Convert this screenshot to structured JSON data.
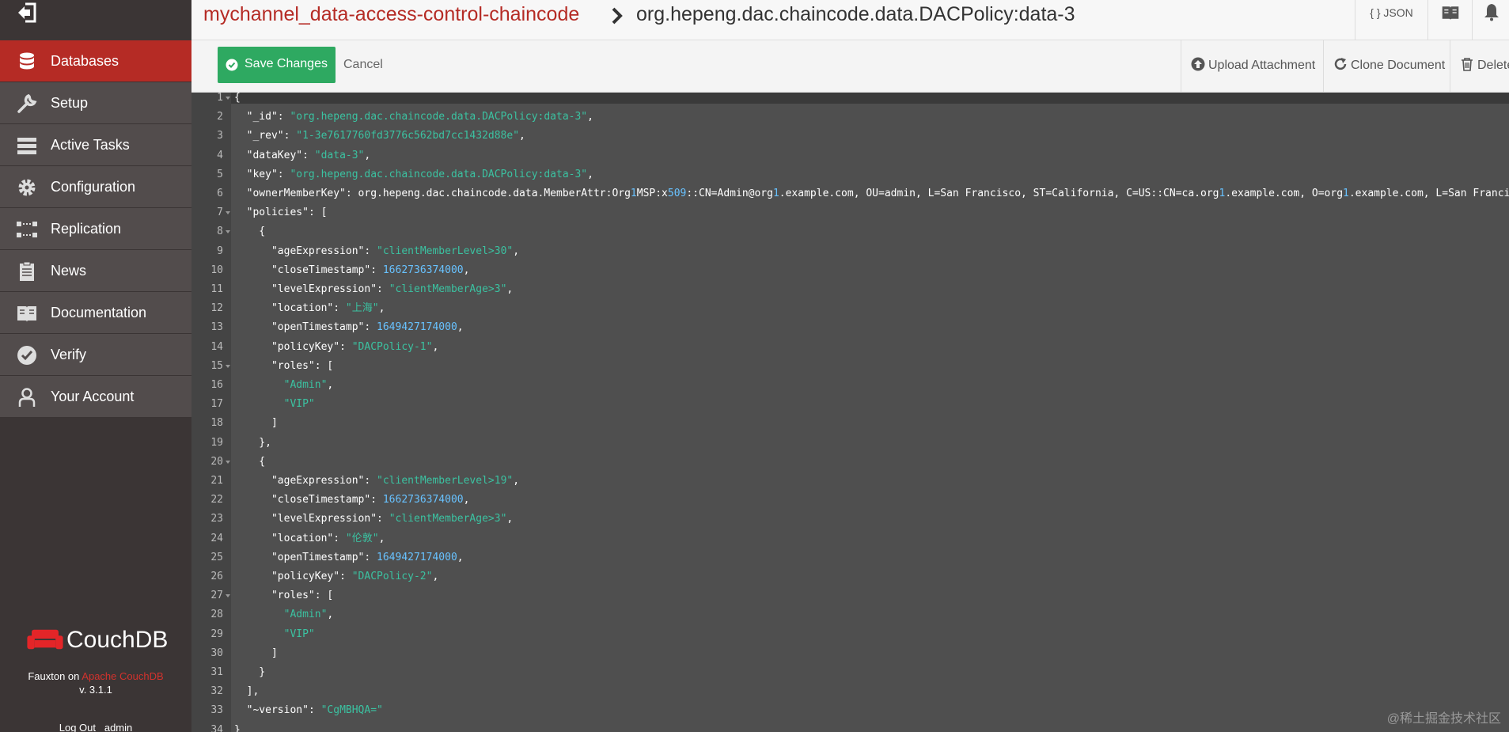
{
  "sidebar": {
    "items": [
      {
        "label": "Databases",
        "icon": "database-icon",
        "active": true
      },
      {
        "label": "Setup",
        "icon": "wrench-icon"
      },
      {
        "label": "Active Tasks",
        "icon": "tasks-icon"
      },
      {
        "label": "Configuration",
        "icon": "gear-icon"
      },
      {
        "label": "Replication",
        "icon": "replication-icon"
      },
      {
        "label": "News",
        "icon": "clipboard-icon"
      },
      {
        "label": "Documentation",
        "icon": "book-icon"
      },
      {
        "label": "Verify",
        "icon": "check-circle-icon"
      },
      {
        "label": "Your Account",
        "icon": "user-icon"
      }
    ],
    "brand": "CouchDB",
    "fauxton_prefix": "Fauxton on ",
    "fauxton_link": "Apache CouchDB",
    "version": "v. 3.1.1",
    "logout": "Log Out",
    "user": "admin"
  },
  "header": {
    "database": "mychannel_data-access-control-chaincode",
    "document": "org.hepeng.dac.chaincode.data.DACPolicy:data-3",
    "json_label": "{ } JSON"
  },
  "toolbar": {
    "save_label": "Save Changes",
    "cancel_label": "Cancel",
    "upload_label": "Upload Attachment",
    "clone_label": "Clone Document",
    "delete_label": "Delete"
  },
  "editor": {
    "lines": [
      "{",
      "  \"_id\": \"org.hepeng.dac.chaincode.data.DACPolicy:data-3\",",
      "  \"_rev\": \"1-3e7617760fd3776c562bd7cc1432d88e\",",
      "  \"dataKey\": \"data-3\",",
      "  \"key\": \"org.hepeng.dac.chaincode.data.DACPolicy:data-3\",",
      "  \"ownerMemberKey\": \"org.hepeng.dac.chaincode.data.MemberAttr:Org1MSP:x509::CN=Admin@org1.example.com, OU=admin, L=San Francisco, ST=California, C=US::CN=ca.org1.example.com, O=org1.example.com, L=San Francisco",
      "  \"policies\": [",
      "    {",
      "      \"ageExpression\": \"clientMemberLevel>30\",",
      "      \"closeTimestamp\": 1662736374000,",
      "      \"levelExpression\": \"clientMemberAge>3\",",
      "      \"location\": \"上海\",",
      "      \"openTimestamp\": 1649427174000,",
      "      \"policyKey\": \"DACPolicy-1\",",
      "      \"roles\": [",
      "        \"Admin\",",
      "        \"VIP\"",
      "      ]",
      "    },",
      "    {",
      "      \"ageExpression\": \"clientMemberLevel>19\",",
      "      \"closeTimestamp\": 1662736374000,",
      "      \"levelExpression\": \"clientMemberAge>3\",",
      "      \"location\": \"伦敦\",",
      "      \"openTimestamp\": 1649427174000,",
      "      \"policyKey\": \"DACPolicy-2\",",
      "      \"roles\": [",
      "        \"Admin\",",
      "        \"VIP\"",
      "      ]",
      "    }",
      "  ],",
      "  \"~version\": \"CgMBHQA=\"",
      "}"
    ],
    "fold_lines": [
      1,
      7,
      8,
      15,
      20,
      27
    ]
  },
  "watermark": "@稀土掘金技术社区",
  "colors": {
    "accent": "#b52b25",
    "save": "#2ea961",
    "string": "#3bc2a1",
    "number": "#68c2ff"
  }
}
